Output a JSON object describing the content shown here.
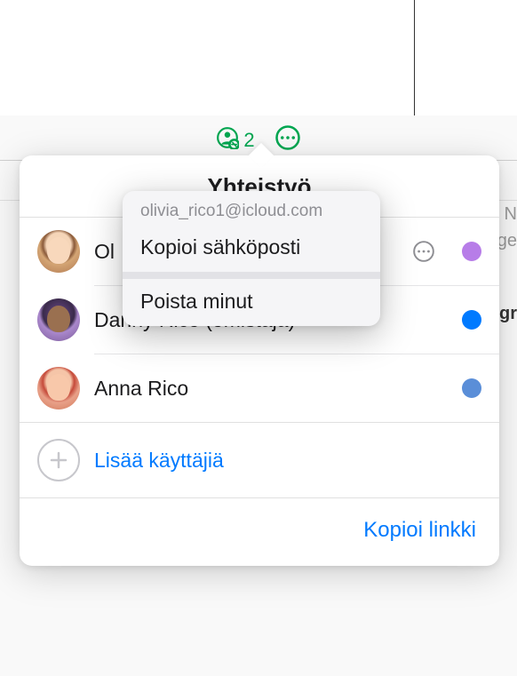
{
  "toolbar": {
    "collab_count": "2"
  },
  "popover": {
    "title": "Yhteistyö",
    "users": [
      {
        "name": "Olivia Rico",
        "short": "Ol"
      },
      {
        "name": "Danny Rico (omistaja)"
      },
      {
        "name": "Anna Rico"
      }
    ],
    "add_label": "Lisää käyttäjiä",
    "copy_link": "Kopioi linkki"
  },
  "context_menu": {
    "email": "olivia_rico1@icloud.com",
    "copy_email": "Kopioi sähköposti",
    "remove_me": "Poista minut"
  },
  "bg": {
    "text1": "t N",
    "text2": "ge",
    "text3": "gr"
  },
  "colors": {
    "accent_green": "#00a650",
    "accent_blue": "#007aff"
  }
}
